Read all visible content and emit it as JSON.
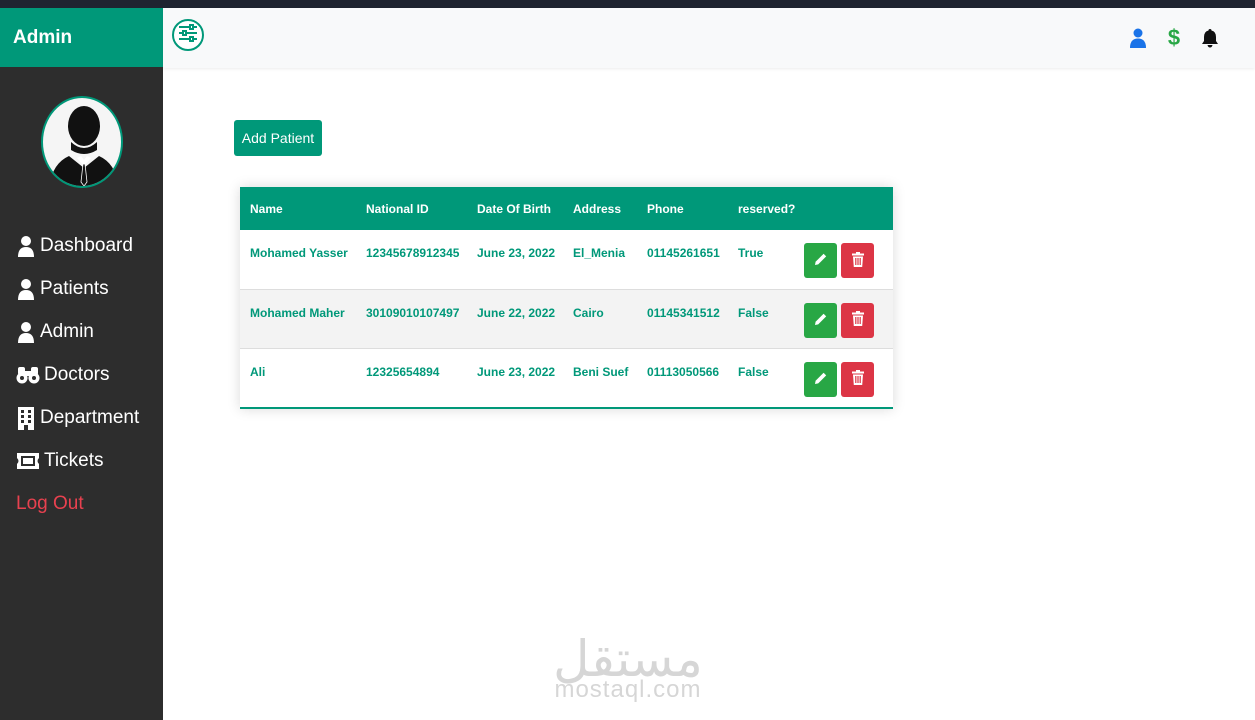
{
  "sidebar": {
    "brand": "Admin",
    "items": [
      {
        "label": "Dashboard",
        "icon": "user-icon"
      },
      {
        "label": "Patients",
        "icon": "user-icon"
      },
      {
        "label": "Admin",
        "icon": "user-icon"
      },
      {
        "label": "Doctors",
        "icon": "binoculars-icon"
      },
      {
        "label": "Department",
        "icon": "building-icon"
      },
      {
        "label": "Tickets",
        "icon": "ticket-icon"
      }
    ],
    "logout": "Log Out"
  },
  "topbar": {
    "icons": [
      "sliders-icon",
      "user-icon",
      "dollar-icon",
      "bell-icon"
    ],
    "dollar_symbol": "$"
  },
  "main": {
    "add_button": "Add Patient",
    "table": {
      "headers": [
        "Name",
        "National ID",
        "Date Of Birth",
        "Address",
        "Phone",
        "reserved?"
      ],
      "rows": [
        [
          "Mohamed Yasser",
          "12345678912345",
          "June 23, 2022",
          "El_Menia",
          "01145261651",
          "True"
        ],
        [
          "Mohamed Maher",
          "30109010107497",
          "June 22, 2022",
          "Cairo",
          "01145341512",
          "False"
        ],
        [
          "Ali",
          "12325654894",
          "June 23, 2022",
          "Beni Suef",
          "01113050566",
          "False"
        ]
      ]
    }
  },
  "colors": {
    "accent": "#009879",
    "sidebar_bg": "#2d2d2d",
    "logout": "#e8414f",
    "edit": "#28a745",
    "delete": "#dc3545",
    "user_icon": "#1a73e8",
    "dollar_icon": "#28a745"
  },
  "watermark": {
    "arabic": "مستقل",
    "latin": "mostaql.com"
  }
}
